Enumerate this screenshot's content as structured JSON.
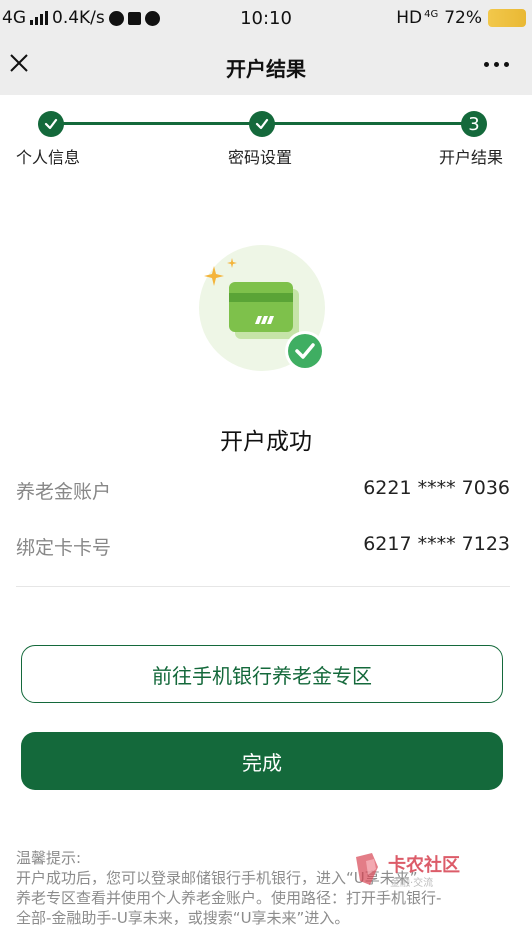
{
  "status_bar": {
    "network": "4G",
    "speed": "0.4K/s",
    "time": "10:10",
    "hd": "HD",
    "net_type": "4G",
    "battery": "72%"
  },
  "nav": {
    "title": "开户结果",
    "close_icon": "close-icon",
    "more_icon": "more-icon"
  },
  "steps": [
    {
      "label": "个人信息",
      "state": "done"
    },
    {
      "label": "密码设置",
      "state": "done"
    },
    {
      "label": "开户结果",
      "state": "current",
      "number": "3"
    }
  ],
  "result": {
    "title": "开户成功",
    "rows": [
      {
        "label": "养老金账户",
        "value": "6221 **** 7036"
      },
      {
        "label": "绑定卡卡号",
        "value": "6217 **** 7123"
      }
    ]
  },
  "buttons": {
    "go_label": "前往手机银行养老金专区",
    "done_label": "完成"
  },
  "tips": {
    "title": "温馨提示:",
    "line1": "开户成功后，您可以登录邮储银行手机银行，进入“U享未来”",
    "line2": "养老专区查看并使用个人养老金账户。使用路径：打开手机银行-",
    "line3": "全部-金融助手-U享未来，或搜索“U享未来”进入。"
  },
  "watermark": {
    "text": "卡农社区",
    "subtext": "金融·交流"
  },
  "colors": {
    "brand_green": "#14693b",
    "nav_bg": "#ededed",
    "card_green": "#7ec14b",
    "check_green": "#3fae62"
  }
}
